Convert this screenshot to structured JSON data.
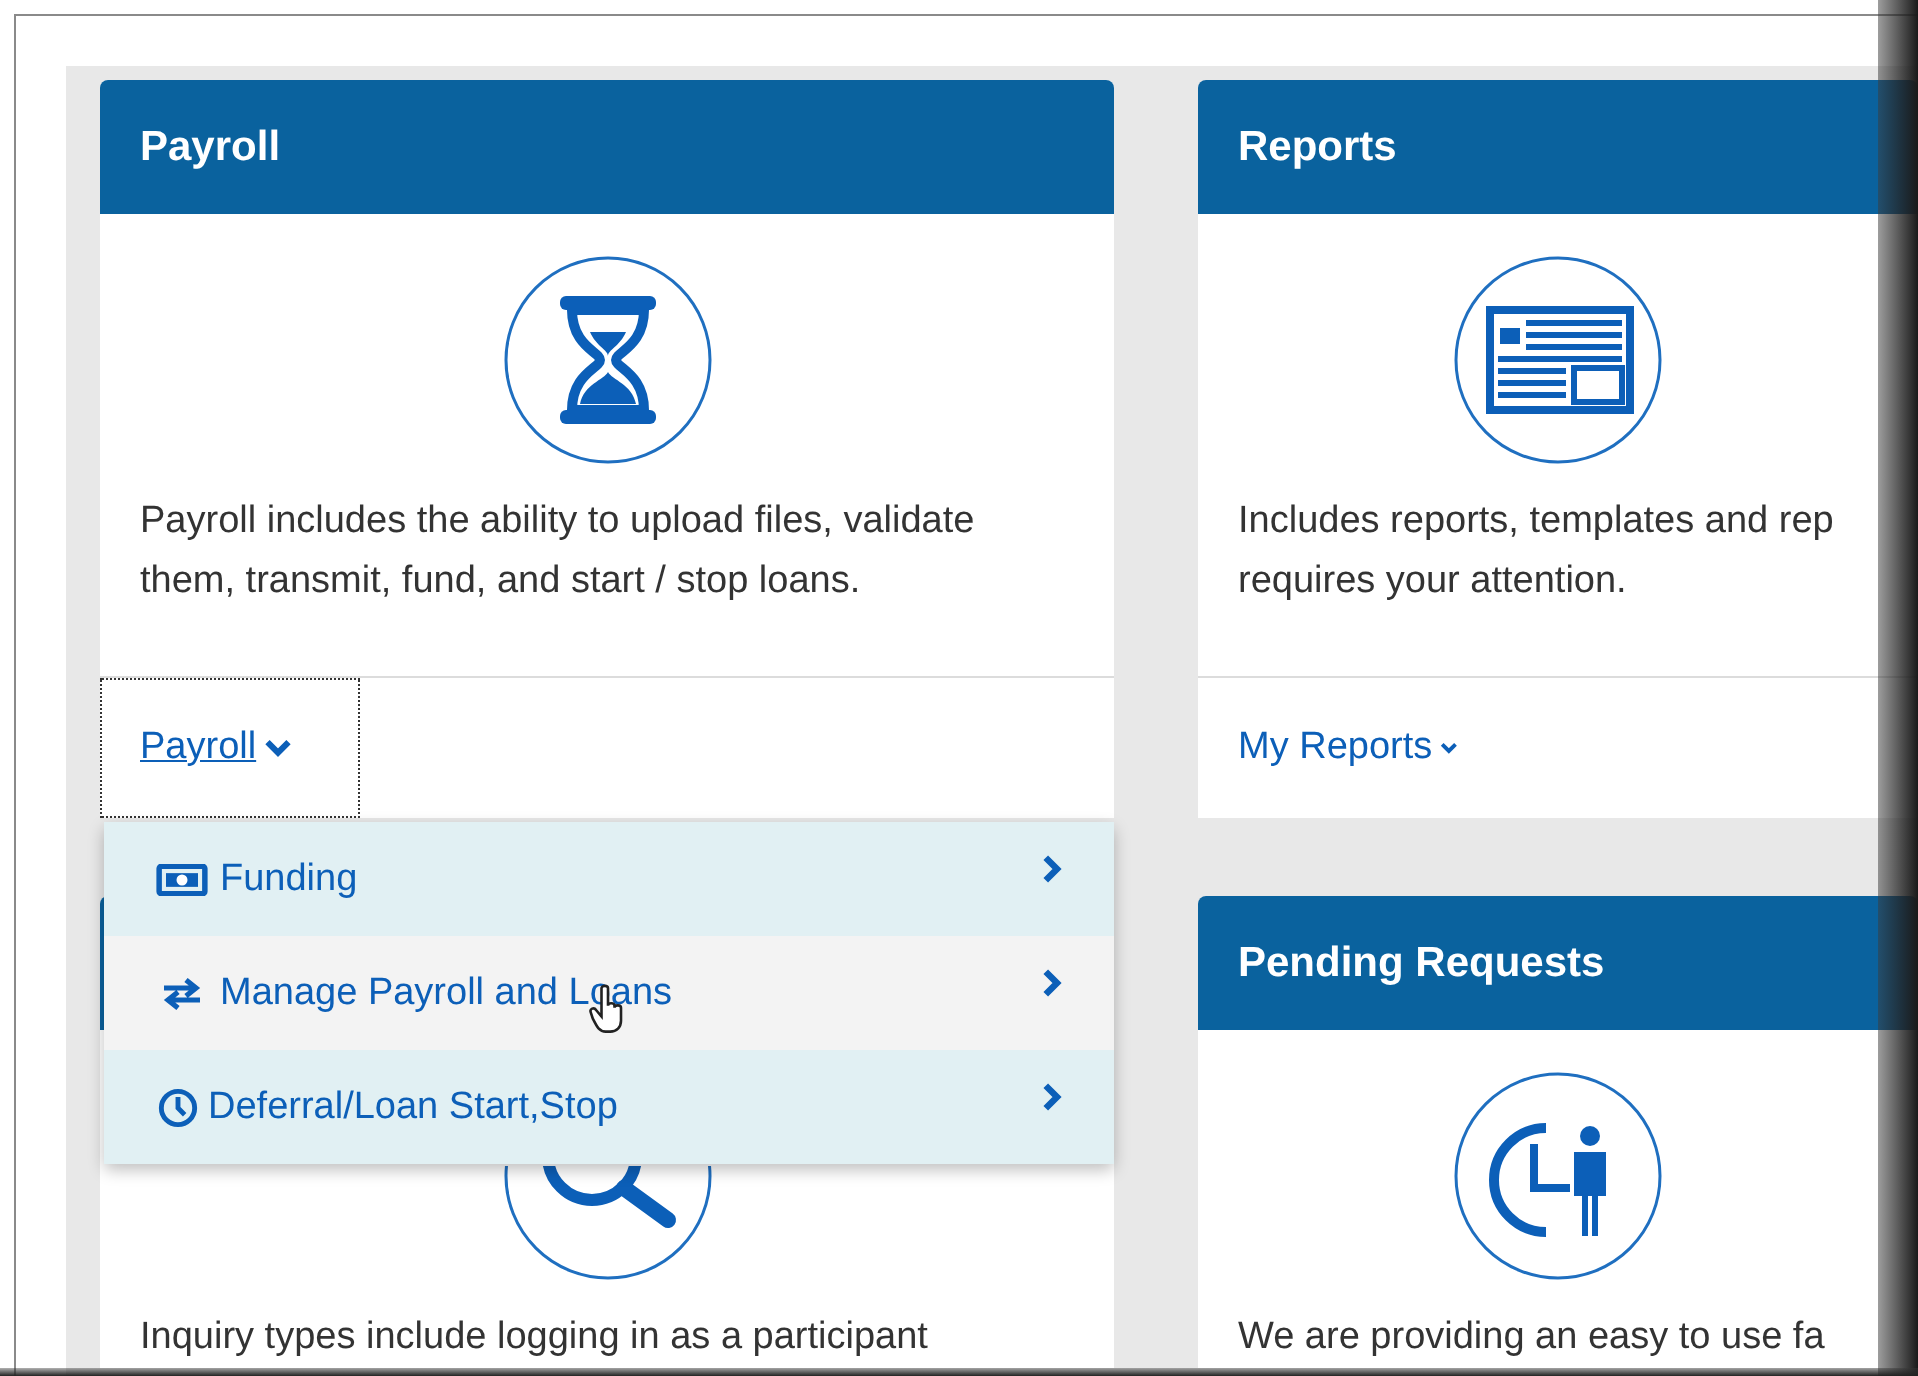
{
  "columns": [
    {
      "cards": [
        {
          "title": "Payroll",
          "description": "Payroll includes the ability to upload files, validate them, transmit, fund, and start / stop loans.",
          "link": {
            "label": "Payroll",
            "expanded": true,
            "menu": [
              {
                "label": "Funding",
                "hovered": false
              },
              {
                "label": "Manage Payroll and Loans",
                "hovered": true
              },
              {
                "label": "Deferral/Loan Start,Stop",
                "hovered": false
              }
            ]
          }
        },
        {
          "description": "Inquiry types include logging in as a participant"
        }
      ]
    },
    {
      "cards": [
        {
          "title": "Reports",
          "description": "Includes reports, templates and rep\nrequires your attention.",
          "link": {
            "label": "My Reports",
            "expanded": false
          }
        },
        {
          "title": "Pending Requests",
          "description": "We are providing an easy to use fa"
        }
      ]
    }
  ]
}
